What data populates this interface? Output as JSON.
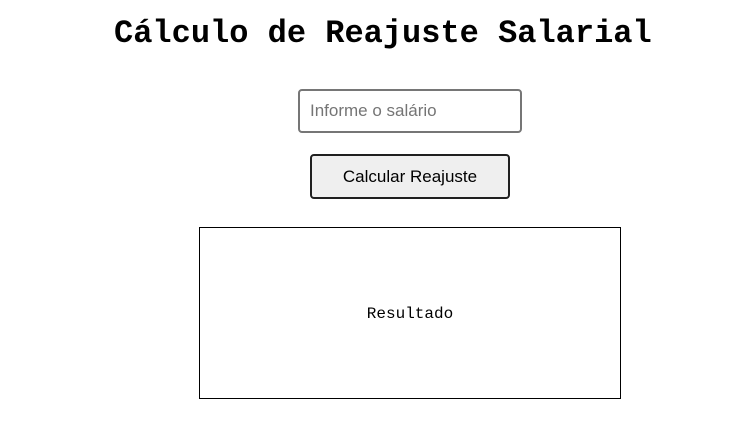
{
  "page": {
    "title": "Cálculo de Reajuste Salarial"
  },
  "form": {
    "salary_input": {
      "placeholder": "Informe o salário",
      "value": ""
    },
    "calculate_button_label": "Calcular Reajuste"
  },
  "result": {
    "text": "Resultado"
  },
  "colors": {
    "background": "#ffffff",
    "text": "#000000",
    "button_background": "#efefef",
    "input_border": "#767676"
  }
}
